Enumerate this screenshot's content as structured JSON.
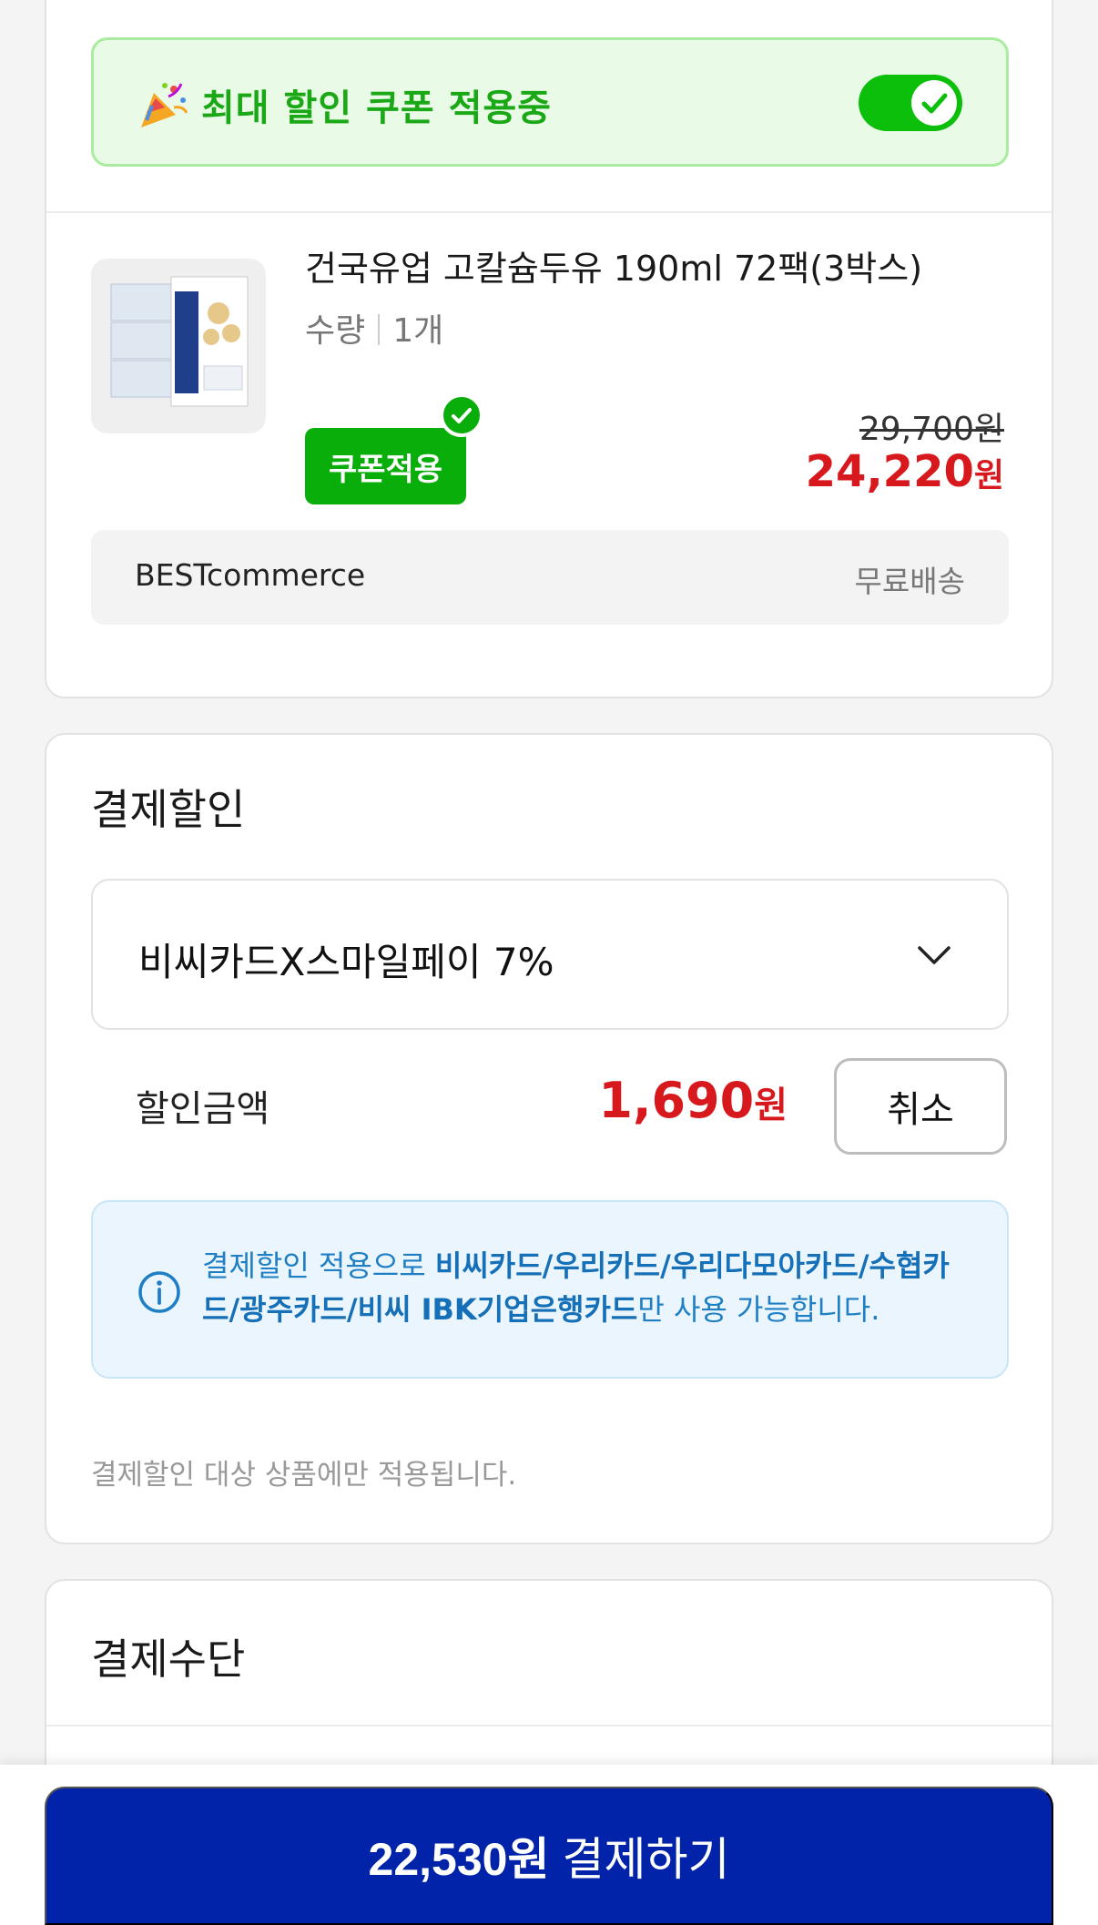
{
  "coupon_banner": {
    "text": "최대 할인 쿠폰 적용중",
    "toggle_on": true,
    "icon": "party-popper-icon",
    "accent_color": "#0bbf0b"
  },
  "product": {
    "name": "건국유업 고칼슘두유 190ml 72팩(3박스)",
    "qty_label": "수량",
    "qty_value": "1개",
    "coupon_badge": "쿠폰적용",
    "original_price": "29,700",
    "original_price_unit": "원",
    "final_price": "24,220",
    "final_price_unit": "원",
    "seller": "BESTcommerce",
    "shipping": "무료배송",
    "thumb_text": "고칼슘두유"
  },
  "payment_discount": {
    "title": "결제할인",
    "selected_option": "비씨카드X스마일페이 7%",
    "amount_label": "할인금액",
    "amount_value": "1,690",
    "amount_unit": "원",
    "cancel_label": "취소",
    "info_prefix": "결제할인 적용으로 ",
    "info_cards": "비씨카드/우리카드/우리다모아카드/수협카드/광주카드/비씨 IBK기업은행카드",
    "info_suffix": "만 사용 가능합니다.",
    "note": "결제할인 대상 상품에만 적용됩니다."
  },
  "payment_method": {
    "title": "결제수단"
  },
  "pay_button": {
    "amount": "22,530원",
    "label": "결제하기",
    "color": "#0023a9"
  }
}
